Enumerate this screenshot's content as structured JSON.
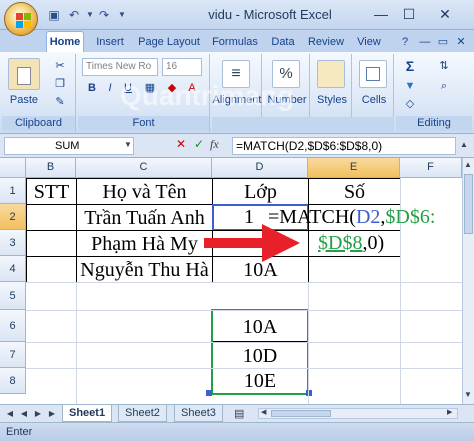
{
  "window": {
    "title": "vidu - Microsoft Excel"
  },
  "ribbon_tabs": [
    "Home",
    "Insert",
    "Page Layout",
    "Formulas",
    "Data",
    "Review",
    "View"
  ],
  "ribbon": {
    "clipboard": {
      "paste_label": "Paste",
      "group_label": "Clipboard"
    },
    "font": {
      "font_name": "Times New Ro",
      "font_size": "16",
      "group_label": "Font"
    },
    "alignment_label": "Alignment",
    "number_label": "Number",
    "styles_label": "Styles",
    "cells_label": "Cells",
    "editing_label": "Editing"
  },
  "formula_bar": {
    "name_box": "SUM",
    "cancel": "✕",
    "enter": "✓",
    "fx": "fx",
    "formula": "=MATCH(D2,$D$6:$D$8,0)"
  },
  "grid": {
    "columns": [
      "B",
      "C",
      "D",
      "E",
      "F"
    ],
    "rows": [
      "1",
      "2",
      "3",
      "4",
      "5",
      "6",
      "7",
      "8"
    ],
    "headers": {
      "stt": "STT",
      "name": "Họ và Tên",
      "class": "Lớp",
      "number": "Số"
    },
    "names": [
      "Trần Tuấn Anh",
      "Phạm Hà My",
      "Nguyễn Thu Hà"
    ],
    "classes": [
      "1",
      "",
      "10A"
    ],
    "lookup": [
      "10A",
      "10D",
      "10E"
    ]
  },
  "edit_formula": {
    "part1": "=MATCH(",
    "part2": "D2",
    "part3": ",",
    "part4": "$D$6:",
    "part5": "$D$8",
    "part6": ",0)"
  },
  "watermark": "uantrimang",
  "sheets": [
    "Sheet1",
    "Sheet2",
    "Sheet3"
  ],
  "status": "Enter",
  "colors": {
    "ref_green": "#22a046",
    "ref_blue": "#3b5fd0",
    "arrow": "#e8202a"
  }
}
